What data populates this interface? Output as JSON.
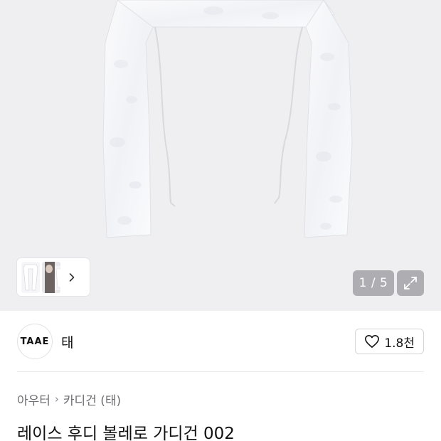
{
  "gallery": {
    "counter": "1 / 5",
    "thumbnails": [
      "thumb-product-flat",
      "thumb-model-photo"
    ],
    "thumb_next_icon": "chevron-right-icon",
    "expand_icon": "expand-icon"
  },
  "brand": {
    "logo_text": "TAAE",
    "name": "태",
    "like_count": "1.8천",
    "like_icon": "heart-outline-icon"
  },
  "breadcrumb": {
    "items": [
      "아우터",
      "카디건 (태)"
    ],
    "separator": "›"
  },
  "product": {
    "title": "레이스 후디 볼레로 가디건 002"
  },
  "colors": {
    "hero_bg": "#efeff1",
    "text": "#111111",
    "muted": "#6e6e73",
    "overlay": "#78787d"
  }
}
